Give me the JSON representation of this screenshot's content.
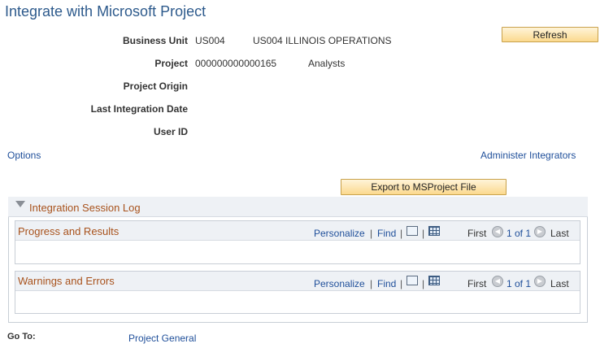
{
  "page": {
    "title": "Integrate with Microsoft Project"
  },
  "fields": {
    "business_unit": {
      "label": "Business Unit",
      "code": "US004",
      "description": "US004 ILLINOIS OPERATIONS"
    },
    "project": {
      "label": "Project",
      "code": "000000000000165",
      "description": "Analysts"
    },
    "project_origin": {
      "label": "Project Origin"
    },
    "last_integration_date": {
      "label": "Last Integration Date"
    },
    "user_id": {
      "label": "User ID"
    }
  },
  "buttons": {
    "refresh": "Refresh",
    "export": "Export to MSProject File"
  },
  "links": {
    "options": "Options",
    "administer_integrators": "Administer Integrators"
  },
  "session_log": {
    "title": "Integration Session Log",
    "grids": [
      {
        "title": "Progress and Results",
        "personalize": "Personalize",
        "find": "Find",
        "first": "First",
        "count": "1 of 1",
        "last": "Last"
      },
      {
        "title": "Warnings and Errors",
        "personalize": "Personalize",
        "find": "Find",
        "first": "First",
        "count": "1 of 1",
        "last": "Last"
      }
    ]
  },
  "goto": {
    "label": "Go To:",
    "link": "Project General"
  },
  "colors": {
    "title": "#2d5a8c",
    "link": "#1f4f9a",
    "section_title": "#a8521c",
    "button": "#fbd98e"
  }
}
